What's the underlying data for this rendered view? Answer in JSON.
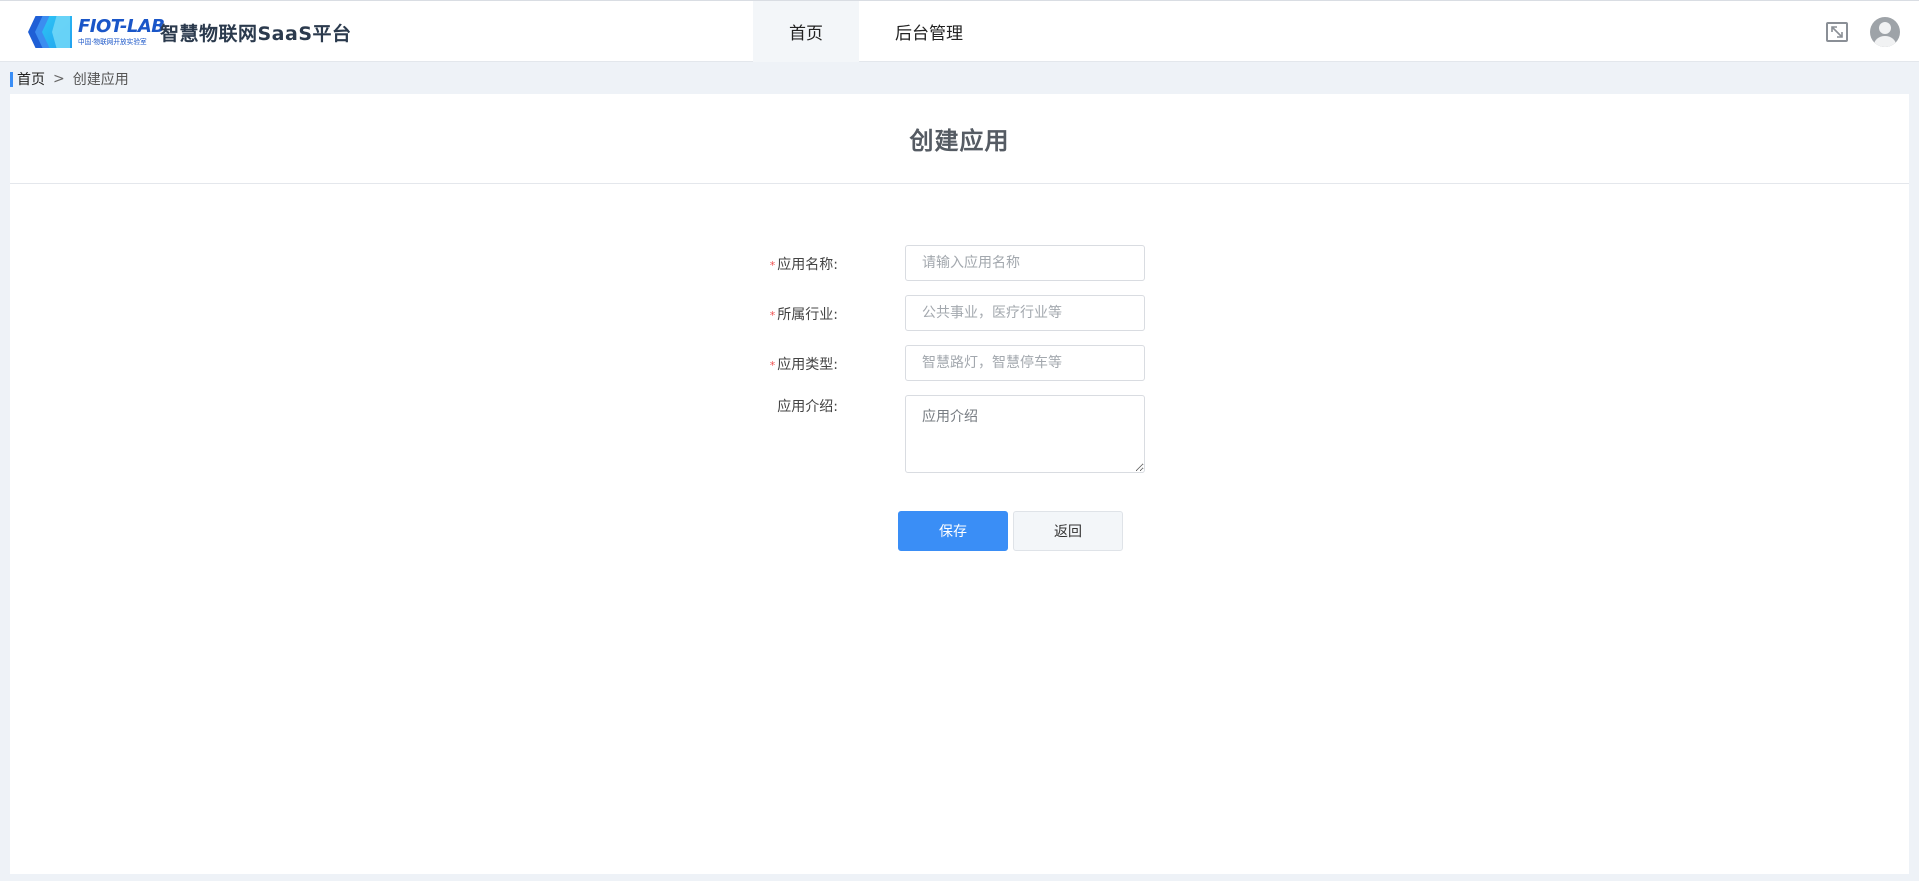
{
  "header": {
    "logo_brand": "FIOT-LAB",
    "logo_subtitle": "中国·物联网开放实验室",
    "platform_title": "智慧物联网SaaS平台",
    "nav": [
      {
        "label": "首页",
        "active": true
      },
      {
        "label": "后台管理",
        "active": false
      }
    ],
    "fullscreen_icon": "fullscreen-icon",
    "avatar_icon": "user-avatar-icon"
  },
  "breadcrumb": {
    "home": "首页",
    "separator": ">",
    "current": "创建应用"
  },
  "page": {
    "title": "创建应用"
  },
  "form": {
    "required_mark": "*",
    "fields": [
      {
        "label": "应用名称:",
        "placeholder": "请输入应用名称",
        "value": "",
        "required": true
      },
      {
        "label": "所属行业:",
        "placeholder": "公共事业，医疗行业等",
        "value": "",
        "required": true
      },
      {
        "label": "应用类型:",
        "placeholder": "智慧路灯，智慧停车等",
        "value": "",
        "required": true
      },
      {
        "label": "应用介绍:",
        "placeholder": "应用介绍",
        "value": "",
        "required": false
      }
    ],
    "save_label": "保存",
    "back_label": "返回"
  },
  "colors": {
    "accent": "#3a8ef6",
    "required": "#f05050",
    "brand": "#1a56c8"
  }
}
